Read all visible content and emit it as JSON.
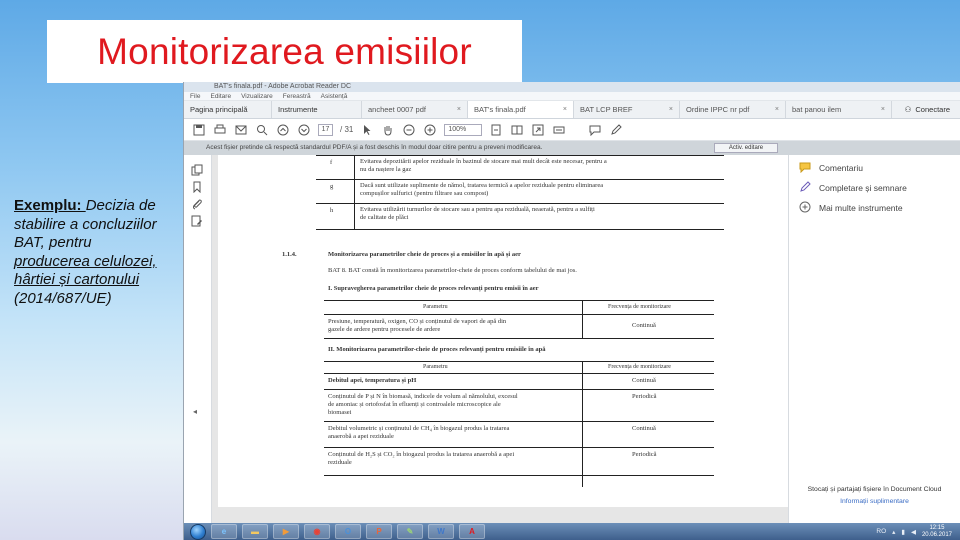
{
  "slide": {
    "title": "Monitorizarea emisiilor",
    "caption_lead": "Exemplu: ",
    "caption_part1": "Decizia de stabilire a concluziilor BAT, pentru ",
    "caption_underlined": "producerea celulozei, hârtiei și cartonului",
    "caption_part2": " (2014/687/UE)"
  },
  "app": {
    "window_title": "BAT's finala.pdf - Adobe Acrobat Reader DC",
    "menu": [
      "File",
      "Editare",
      "Vizualizare",
      "Fereastră",
      "Asistență"
    ],
    "tabs": [
      {
        "label": "Pagina principală"
      },
      {
        "label": "Instrumente"
      },
      {
        "label": "ancheet 0007 pdf"
      },
      {
        "label": "BAT's finala.pdf"
      },
      {
        "label": "BAT LCP BREF"
      },
      {
        "label": "Ordine IPPC nr pdf"
      },
      {
        "label": "bat panou ilem"
      }
    ],
    "connect_label": "Conectare",
    "page_current": "17",
    "page_total": "/ 31",
    "zoom": "100%",
    "notice_text": "Acest fișier pretinde că respectă standardul PDF/A și a fost deschis în modul doar citire pentru a preveni modificarea.",
    "notice_button": "Activ. editare"
  },
  "document": {
    "rows_top": [
      {
        "letter": "f",
        "text1": "Evitarea depozitării apelor reziduale în bazinul de stocare mai mult decât este necesar, pentru a",
        "text2": "nu da naștere la gaz"
      },
      {
        "letter": "g",
        "text1": "Dacă sunt utilizate suplimente de nămol, tratarea termică a apelor reziduale pentru eliminarea",
        "text2": "compușilor sulfurici (pentru filtrare sau compost)"
      },
      {
        "letter": "h",
        "text1": "Evitarea utilizării turnurilor de stocare sau a pentru apa reziduală, neaerată, pentru a sulfiți",
        "text2": "de calitate de plăci"
      }
    ],
    "section_number": "1.1.4.",
    "section_title": "Monitorizarea parametrilor cheie de proces și a emisiilor în apă și aer",
    "bat_line": "BAT 8.   BAT constă în monitorizarea parametrilor-cheie de proces conform tabelului de mai jos.",
    "sub1": "I.   Supravegherea parametrilor cheie de proces relevanți pentru emisii în aer",
    "t1_head": [
      "Parametru",
      "Frecvența de monitorizare"
    ],
    "t1_rows": [
      {
        "param1": "Presiune, temperatură, oxigen, CO și conținutul de vapori de apă din",
        "param2": "gazele de ardere pentru procesele de ardere",
        "freq": "Continuă"
      }
    ],
    "sub2": "II.   Monitorizarea parametrilor-cheie de proces relevanți pentru emisiile în apă",
    "t2_head": [
      "Parametru",
      "Frecvența de monitorizare"
    ],
    "t2_rows": [
      {
        "param1": "Debitul apei, temperatura și pH",
        "param2": "",
        "param3": "",
        "freq": "Continuă"
      },
      {
        "param1": "Conținutul de P și N în biomasă, indicele de volum al nămolului, excesul",
        "param2": "de amoniac și ortofosfat în efluenți și controalele microscopice ale",
        "param3": "biomasei",
        "freq": "Periodică"
      },
      {
        "param1": "Debitul volumetric și conținutul de CH₄ în biogazul produs la tratarea",
        "param2": "anaerobă a apei reziduale",
        "param3": "",
        "freq": "Continuă"
      },
      {
        "param1": "Conținutul de H₂S și CO₂ în biogazul produs la tratarea anaerobă a apei",
        "param2": "reziduale",
        "param3": "",
        "freq": "Periodică"
      }
    ]
  },
  "right_panel": {
    "items": [
      {
        "label": "Comentariu"
      },
      {
        "label": "Completare și semnare"
      },
      {
        "label": "Mai multe instrumente"
      }
    ],
    "cloud_text": "Stocați și partajați fișiere în Document Cloud",
    "cloud_link": "Informații suplimentare"
  },
  "taskbar": {
    "lang": "RO",
    "time": "12:15",
    "date": "20.06.2017"
  }
}
